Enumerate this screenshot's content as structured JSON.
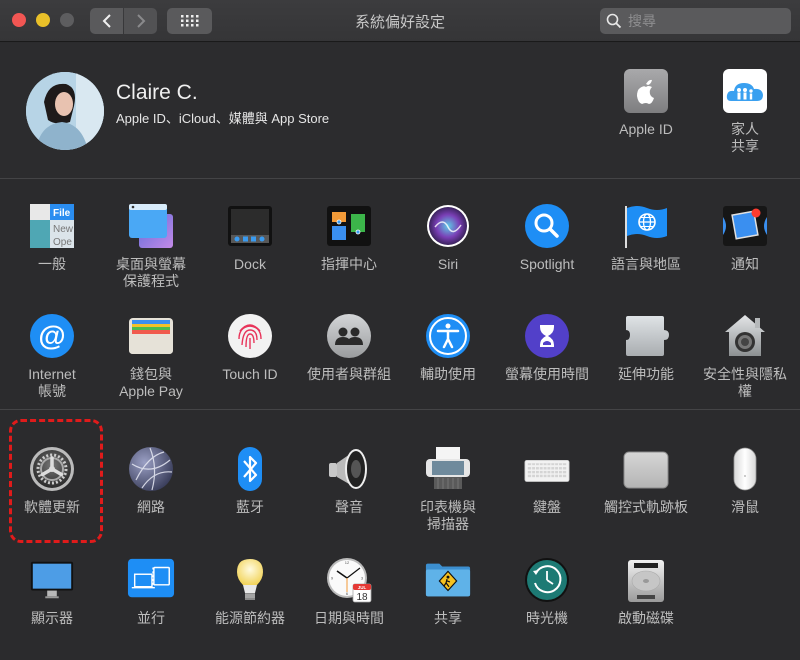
{
  "window": {
    "title": "系統偏好設定",
    "search_placeholder": "搜尋",
    "back_icon": "chevron-left-icon",
    "forward_icon": "chevron-right-icon",
    "grid_icon": "grid-icon"
  },
  "user": {
    "name": "Claire C.",
    "subtitle": "Apple ID、iCloud、媒體與 App Store"
  },
  "account_panes": [
    {
      "label": "Apple ID",
      "icon": "apple-logo-icon"
    },
    {
      "label": "家人\n共享",
      "icon": "family-sharing-icon"
    }
  ],
  "section1": [
    {
      "label": "一般",
      "icon": "general-icon"
    },
    {
      "label": "桌面與螢幕\n保護程式",
      "icon": "desktop-screensaver-icon"
    },
    {
      "label": "Dock",
      "icon": "dock-icon"
    },
    {
      "label": "指揮中心",
      "icon": "mission-control-icon"
    },
    {
      "label": "Siri",
      "icon": "siri-icon"
    },
    {
      "label": "Spotlight",
      "icon": "spotlight-icon"
    },
    {
      "label": "語言與地區",
      "icon": "language-region-icon"
    },
    {
      "label": "通知",
      "icon": "notifications-icon"
    },
    {
      "label": "Internet\n帳號",
      "icon": "internet-accounts-icon"
    },
    {
      "label": "錢包與\nApple Pay",
      "icon": "wallet-icon"
    },
    {
      "label": "Touch ID",
      "icon": "fingerprint-icon"
    },
    {
      "label": "使用者與群組",
      "icon": "users-groups-icon"
    },
    {
      "label": "輔助使用",
      "icon": "accessibility-icon"
    },
    {
      "label": "螢幕使用時間",
      "icon": "screen-time-icon"
    },
    {
      "label": "延伸功能",
      "icon": "extensions-icon"
    },
    {
      "label": "安全性與隱私權",
      "icon": "security-privacy-icon"
    }
  ],
  "section2": [
    {
      "label": "軟體更新",
      "icon": "software-update-icon"
    },
    {
      "label": "網路",
      "icon": "network-icon"
    },
    {
      "label": "藍牙",
      "icon": "bluetooth-icon"
    },
    {
      "label": "聲音",
      "icon": "sound-icon"
    },
    {
      "label": "印表機與\n掃描器",
      "icon": "printer-icon"
    },
    {
      "label": "鍵盤",
      "icon": "keyboard-icon"
    },
    {
      "label": "觸控式軌跡板",
      "icon": "trackpad-icon"
    },
    {
      "label": "滑鼠",
      "icon": "mouse-icon"
    },
    {
      "label": "顯示器",
      "icon": "display-icon"
    },
    {
      "label": "並行",
      "icon": "sidecar-icon"
    },
    {
      "label": "能源節約器",
      "icon": "energy-saver-icon"
    },
    {
      "label": "日期與時間",
      "icon": "date-time-icon"
    },
    {
      "label": "共享",
      "icon": "sharing-icon"
    },
    {
      "label": "時光機",
      "icon": "time-machine-icon"
    },
    {
      "label": "啟動磁碟",
      "icon": "startup-disk-icon"
    }
  ],
  "calendar_icon_text": {
    "month": "JUL",
    "day": "18"
  },
  "highlight_color": "#e01b1b"
}
